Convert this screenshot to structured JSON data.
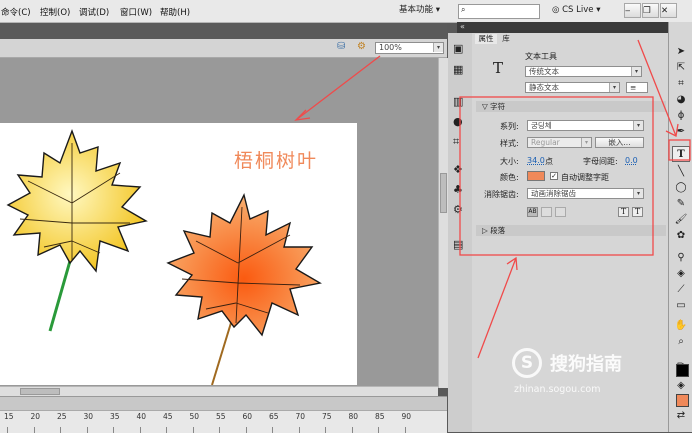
{
  "menu": {
    "items": [
      "命令(C)",
      "控制(O)",
      "调试(D)",
      "窗口(W)",
      "帮助(H)"
    ],
    "workspace": "基本功能",
    "search_placeholder": "",
    "cs_live": "CS Live"
  },
  "document": {
    "zoom": "100%",
    "stage_text": "梧桐树叶",
    "ruler_numbers": [
      "15",
      "20",
      "25",
      "30",
      "35",
      "40",
      "45",
      "50",
      "55",
      "60",
      "65",
      "70",
      "75",
      "80",
      "85",
      "90"
    ]
  },
  "panel": {
    "tabs": [
      "属性",
      "库"
    ],
    "tool_name": "文本工具",
    "text_engine": "传统文本",
    "text_type": "静态文本",
    "character_section": "字符",
    "family_label": "系列:",
    "family_value": "궁딩체",
    "style_label": "样式:",
    "style_value": "Regular",
    "embed_button": "嵌入...",
    "size_label": "大小:",
    "size_value": "34.0",
    "size_unit": "点",
    "spacing_label": "字母间距:",
    "spacing_value": "0.0",
    "color_label": "颜色:",
    "auto_kern": "自动调整字距",
    "aa_label": "消除锯齿:",
    "aa_value": "动画消除锯齿",
    "paragraph_section": "段落"
  },
  "watermark": {
    "brand": "搜狗指南",
    "url": "zhinan.sogou.com"
  },
  "colors": {
    "annotation": "#f04a4a",
    "stage_text": "#f0895a",
    "leaf_yellow": "#f5c518",
    "leaf_orange": "#f07a2a"
  }
}
